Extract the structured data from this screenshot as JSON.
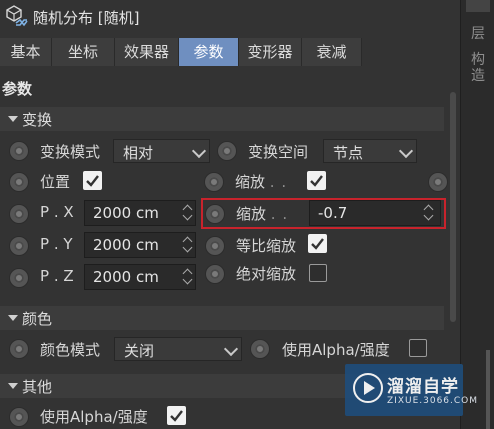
{
  "title": "随机分布 [随机]",
  "tabs": [
    "基本",
    "坐标",
    "效果器",
    "参数",
    "变形器",
    "衰减"
  ],
  "active_tab": "参数",
  "heading": "参数",
  "right_panel": {
    "labels": [
      "层",
      "构造"
    ]
  },
  "sections": {
    "transform": "变换",
    "color": "颜色",
    "other": "其他"
  },
  "transform": {
    "mode_label": "变换模式",
    "mode_value": "相对",
    "space_label": "变换空间",
    "space_value": "节点",
    "position_label": "位置",
    "position_checked": true,
    "scale_top_label": "缩放",
    "scale_top_checked": true,
    "px_label": "P . X",
    "px_value": "2000 cm",
    "py_label": "P . Y",
    "py_value": "2000 cm",
    "pz_label": "P . Z",
    "pz_value": "2000 cm",
    "scale_label": "缩放",
    "scale_value": "-0.7",
    "uniform_label": "等比缩放",
    "uniform_checked": true,
    "absolute_label": "绝对缩放",
    "absolute_checked": false,
    "dots": ". ."
  },
  "color": {
    "mode_label": "颜色模式",
    "mode_value": "关闭",
    "use_alpha_label": "使用Alpha/强度",
    "use_alpha_checked": false
  },
  "other": {
    "use_alpha_label": "使用Alpha/强度",
    "use_alpha_checked": true
  },
  "watermark": {
    "title": "溜溜自学",
    "url": "ZIXUE.3066.COM"
  },
  "colors": {
    "background": "#333333",
    "active_tab": "#6f8fc0",
    "highlight_border": "#c8232c",
    "watermark": "#1f4d7a"
  }
}
